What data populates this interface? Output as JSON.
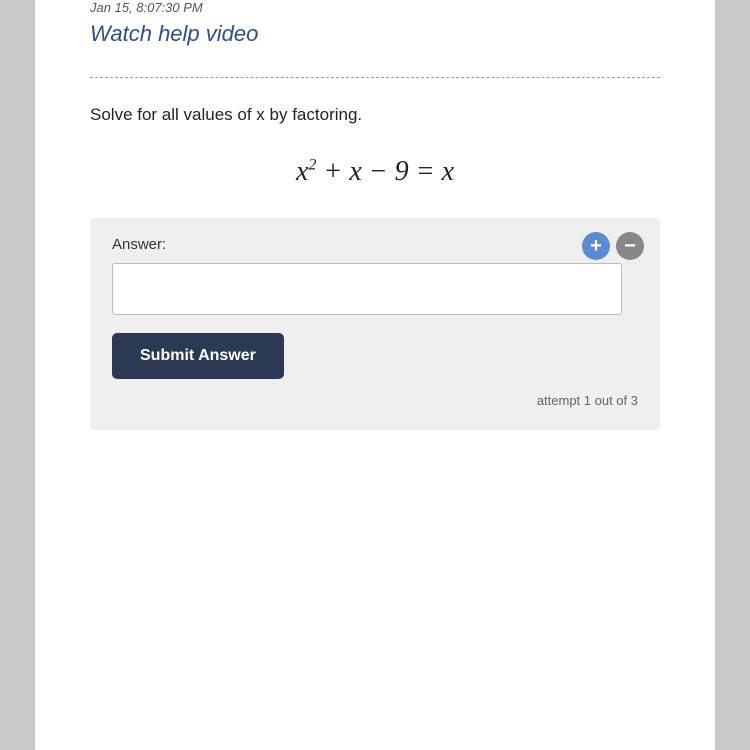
{
  "top": {
    "timestamp": "Jan 15, 8:07:30 PM",
    "watch_help_label": "Watch help video"
  },
  "problem": {
    "instruction": "Solve for all values of x by factoring.",
    "equation_html": "x<sup>2</sup> + x − 9 = x"
  },
  "answer_area": {
    "label": "Answer:",
    "input_placeholder": "",
    "submit_label": "Submit Answer",
    "attempt_text": "attempt 1 out of 3",
    "plus_icon": "+",
    "minus_icon": "−"
  }
}
